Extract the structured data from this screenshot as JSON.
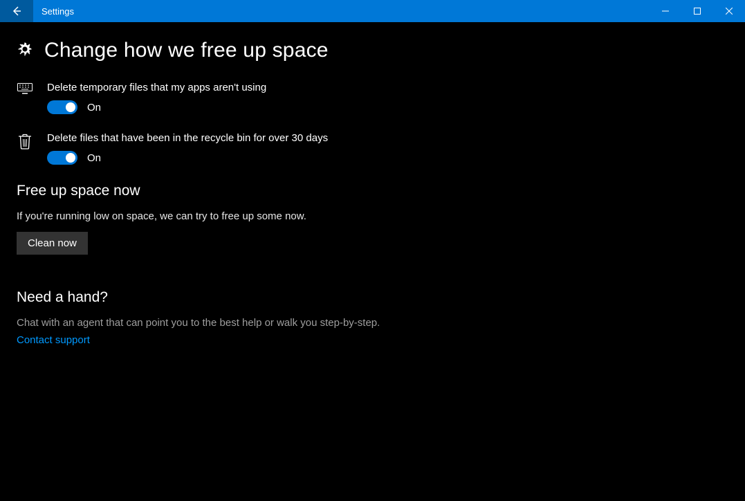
{
  "titlebar": {
    "title": "Settings"
  },
  "page": {
    "title": "Change how we free up space"
  },
  "settings": {
    "tempFiles": {
      "label": "Delete temporary files that my apps aren't using",
      "state": "On"
    },
    "recycleBin": {
      "label": "Delete files that have been in the recycle bin for over 30 days",
      "state": "On"
    }
  },
  "freeUp": {
    "title": "Free up space now",
    "desc": "If you're running low on space, we can try to free up some now.",
    "button": "Clean now"
  },
  "help": {
    "title": "Need a hand?",
    "desc": "Chat with an agent that can point you to the best help or walk you step-by-step.",
    "link": "Contact support"
  }
}
